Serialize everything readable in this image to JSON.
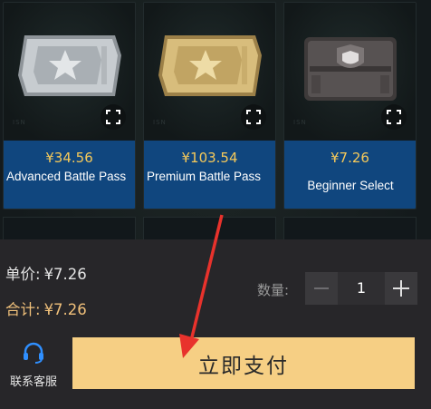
{
  "products": [
    {
      "price": "¥34.56",
      "name": "Advanced Battle Pass",
      "image": "silver-ticket"
    },
    {
      "price": "¥103.54",
      "name": "Premium Battle Pass",
      "image": "gold-ticket"
    },
    {
      "price": "¥7.26",
      "name": "Beginner Select",
      "image": "crate"
    }
  ],
  "checkout": {
    "unit_price_label": "单价:",
    "unit_price_value": "¥7.26",
    "total_label": "合计:",
    "total_value": "¥7.26",
    "quantity_label": "数量:",
    "quantity_value": "1",
    "pay_button": "立即支付",
    "support_label": "联系客服"
  },
  "colors": {
    "accent": "#f6cf84",
    "card_info": "#10467e",
    "price": "#f5c95a",
    "annotation_arrow": "#e8322c"
  },
  "icons": [
    "expand-icon",
    "minus-icon",
    "plus-icon",
    "headset-icon"
  ]
}
